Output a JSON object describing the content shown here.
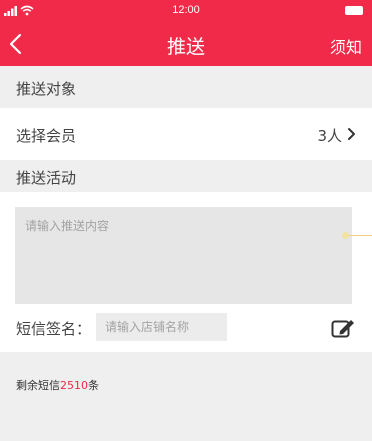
{
  "status_bar": {
    "time": "12:00"
  },
  "nav": {
    "title": "推送",
    "right_label": "须知"
  },
  "sections": {
    "target": {
      "title": "推送对象"
    },
    "activity": {
      "title": "推送活动"
    }
  },
  "select_member": {
    "label": "选择会员",
    "value": "3人"
  },
  "content": {
    "placeholder": "请输入推送内容"
  },
  "signature": {
    "label": "短信签名：",
    "placeholder": "请输入店铺名称"
  },
  "remaining": {
    "prefix": "剩余短信",
    "count": "2510",
    "suffix": "条"
  },
  "colors": {
    "brand": "#f02a48",
    "background": "#efefef",
    "input_bg": "#e6e6e6"
  }
}
